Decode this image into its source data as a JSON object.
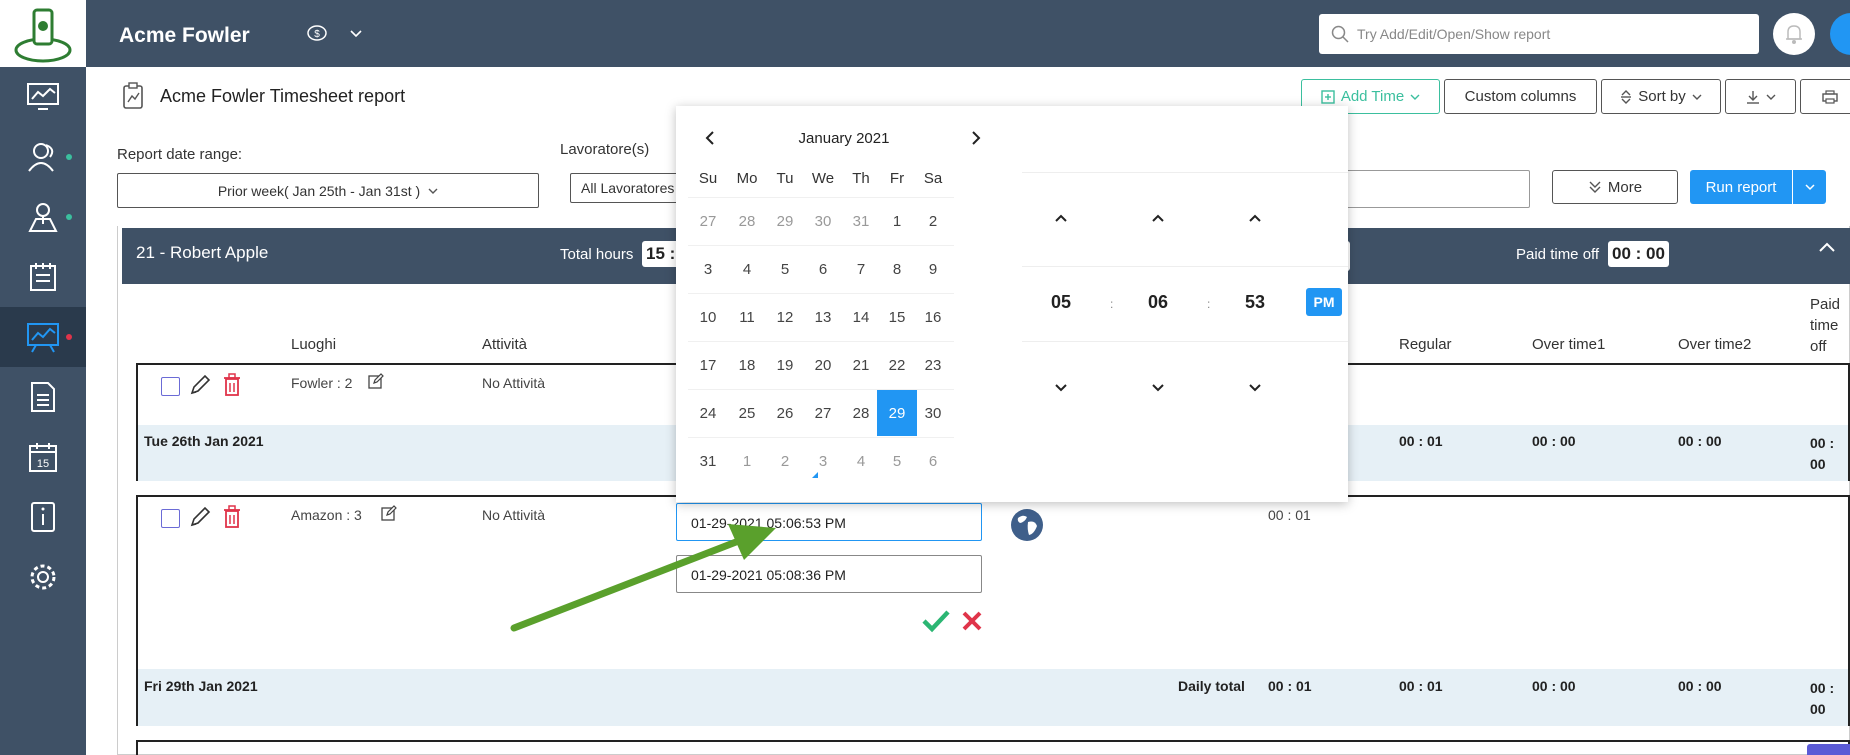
{
  "app": {
    "title": "Acme Fowler"
  },
  "search": {
    "placeholder": "Try Add/Edit/Open/Show report"
  },
  "report": {
    "title": "Acme Fowler Timesheet report",
    "toolbar": {
      "add_time": "Add Time",
      "custom_columns": "Custom columns",
      "sort_by": "Sort by"
    },
    "date_range_label": "Report date range:",
    "date_range_value": "Prior week( Jan 25th - Jan 31st )",
    "worker_label": "Lavoratore(s)",
    "worker_value": "All Lavoratores",
    "more": "More",
    "run": "Run report"
  },
  "employee": {
    "name": "21 - Robert Apple",
    "total_hours_label": "Total hours",
    "total_hours_value": "15 :",
    "pto_label": "Paid time off",
    "pto_value": "00 : 00"
  },
  "columns": {
    "places": "Luoghi",
    "activity": "Attività",
    "regular": "Regular",
    "overtime1": "Over time1",
    "overtime2": "Over time2",
    "pto_line1": "Paid",
    "pto_line2": "time",
    "pto_line3": "off"
  },
  "entries": [
    {
      "place": "Fowler : 2",
      "activity": "No Attività",
      "day": "Tue 26th Jan 2021",
      "regular": "00 : 01",
      "ot1": "00 : 00",
      "ot2": "00 : 00",
      "pto1": "00 :",
      "pto2": "00"
    },
    {
      "place": "Amazon : 3",
      "activity": "No Attività",
      "start": "01-29-2021 05:06:53 PM",
      "end": "01-29-2021 05:08:36 PM",
      "duration": "00 : 01",
      "day": "Fri 29th Jan 2021",
      "daily_total_label": "Daily total",
      "daily_total": "00 : 01",
      "regular": "00 : 01",
      "ot1": "00 : 00",
      "ot2": "00 : 00",
      "pto1": "00 :",
      "pto2": "00"
    }
  ],
  "picker": {
    "month": "January 2021",
    "dow": [
      "Su",
      "Mo",
      "Tu",
      "We",
      "Th",
      "Fr",
      "Sa"
    ],
    "weeks": [
      [
        "27",
        "28",
        "29",
        "30",
        "31",
        "1",
        "2"
      ],
      [
        "3",
        "4",
        "5",
        "6",
        "7",
        "8",
        "9"
      ],
      [
        "10",
        "11",
        "12",
        "13",
        "14",
        "15",
        "16"
      ],
      [
        "17",
        "18",
        "19",
        "20",
        "21",
        "22",
        "23"
      ],
      [
        "24",
        "25",
        "26",
        "27",
        "28",
        "29",
        "30"
      ],
      [
        "31",
        "1",
        "2",
        "3",
        "4",
        "5",
        "6"
      ]
    ],
    "selected_day": "29",
    "hour": "05",
    "minute": "06",
    "second": "53",
    "ampm": "PM",
    "separator": ":"
  },
  "colors": {
    "sidebar": "#3f5166",
    "accent": "#2196f3",
    "green": "#3bbf9e",
    "delete": "#e0344a",
    "arrow": "#5aa02c"
  }
}
